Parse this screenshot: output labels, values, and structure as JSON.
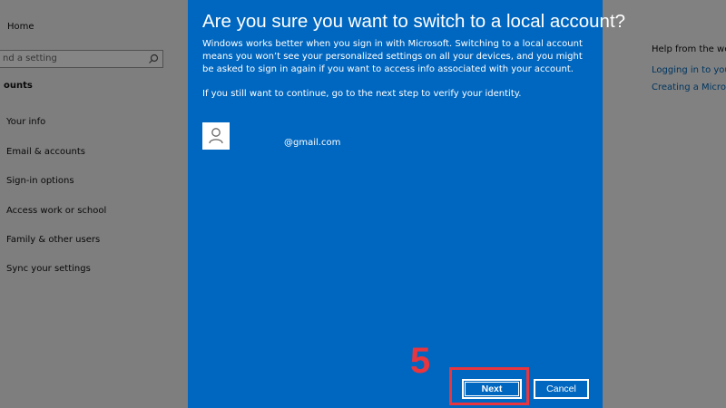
{
  "background": {
    "nav_home": "Home",
    "search_placeholder": "nd a setting",
    "section_title": "ounts",
    "nav_items": [
      {
        "label": "Your info"
      },
      {
        "label": "Email & accounts"
      },
      {
        "label": "Sign-in options"
      },
      {
        "label": "Access work or school"
      },
      {
        "label": "Family & other users"
      },
      {
        "label": "Sync your settings"
      }
    ],
    "help_title": "Help from the web",
    "help_links": [
      {
        "label": "Logging in to your"
      },
      {
        "label": "Creating a Microsoft"
      }
    ]
  },
  "dialog": {
    "title": "Are you sure you want to switch to a local account?",
    "body": "Windows works better when you sign in with Microsoft. Switching to a local account means you won’t see your personalized settings on all your devices, and you might be asked to sign in again if you want to access info associated with your account.",
    "body2": "If you still want to continue, go to the next step to verify your identity.",
    "email": "@gmail.com",
    "next_label": "Next",
    "cancel_label": "Cancel"
  },
  "annotation": {
    "step_number": "5",
    "color": "#e8353e"
  },
  "colors": {
    "dialog_bg": "#0067c0",
    "link": "#0067b8"
  }
}
